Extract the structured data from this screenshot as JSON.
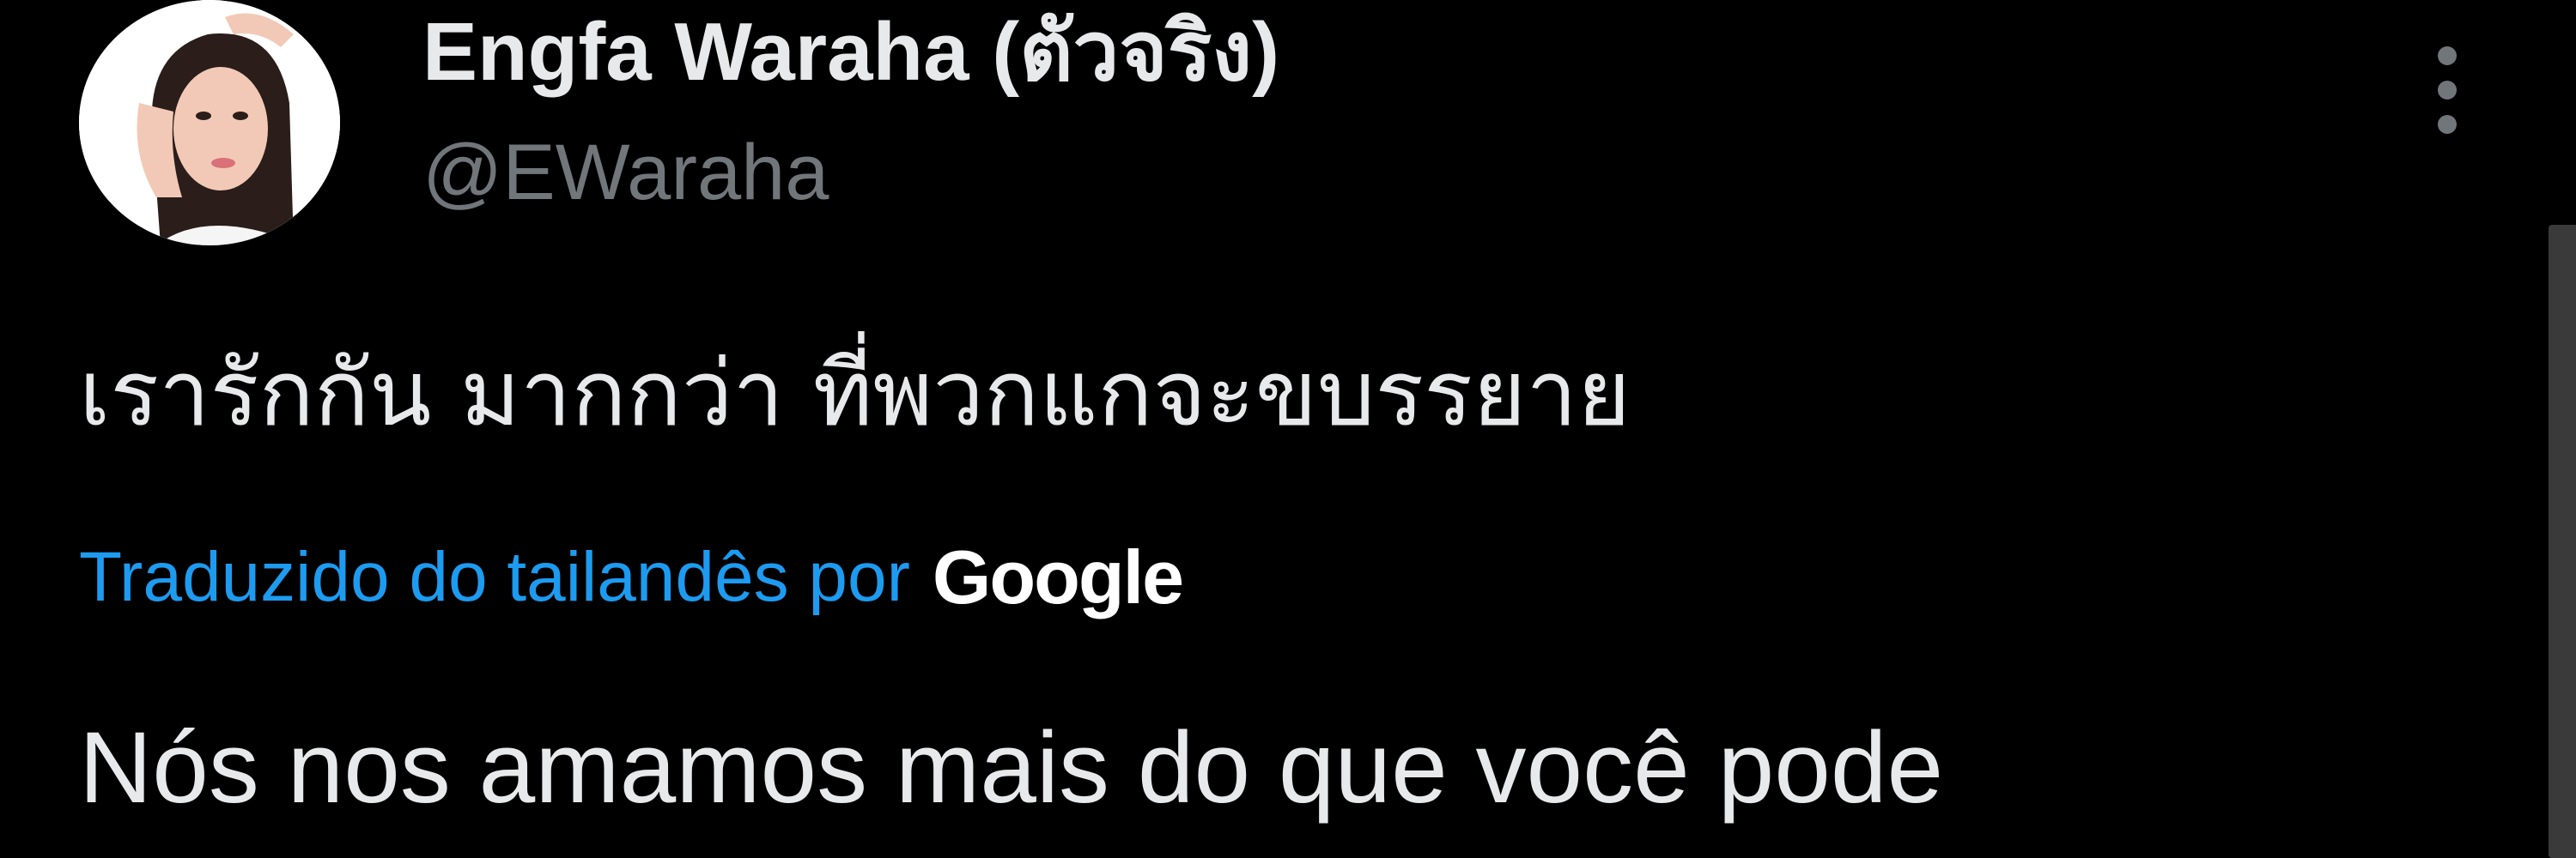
{
  "tweet": {
    "author": {
      "display_name": "Engfa Waraha (ตัวจริง)",
      "handle": "@EWaraha",
      "avatar_icon": "profile-photo"
    },
    "more_icon": "more-vertical-icon",
    "text": "เรารักกัน มากกว่า ที่พวกแกจะขบรรยาย",
    "translation": {
      "label": "Traduzido do tailandês por",
      "provider": "Google",
      "text": "Nós nos amamos mais do que você pode"
    }
  },
  "colors": {
    "background": "#000000",
    "primary_text": "#e7e9ea",
    "secondary_text": "#71767b",
    "link": "#1d9bf0"
  }
}
